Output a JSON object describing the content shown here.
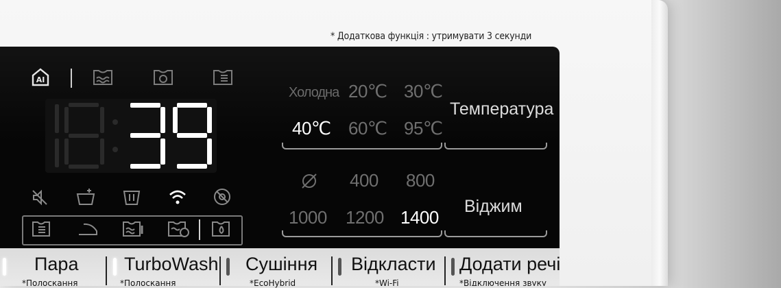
{
  "note": "* Додаткова функція : утримувати 3 секунди",
  "display": {
    "time": "39",
    "icons": [
      "ai-icon",
      "wash-icon",
      "rinse-icon",
      "spin-icon",
      "mute-icon",
      "detergent-icon",
      "tub-clean-icon",
      "wifi-icon",
      "child-lock-icon",
      "steam-icon",
      "iron-icon",
      "temp-dry-icon",
      "timed-dry-icon",
      "drip-icon"
    ]
  },
  "temperature": {
    "title": "Температура",
    "options": [
      "Холодна",
      "20℃",
      "30℃",
      "40℃",
      "60℃",
      "95℃"
    ],
    "selected": "40℃"
  },
  "spin": {
    "title": "Віджим",
    "options": [
      "400",
      "800",
      "1000",
      "1200",
      "1400"
    ],
    "selected": "1400"
  },
  "buttons": [
    {
      "label": "Пара",
      "sub": "*Полоскання"
    },
    {
      "label": "TurboWash",
      "sub": "*Полоскання"
    },
    {
      "label": "Сушіння",
      "sub": "*EcoHybrid"
    },
    {
      "label": "Відкласти",
      "sub": "*Wi-Fi"
    },
    {
      "label": "Додати речі",
      "sub": "*Відключення звуку"
    }
  ]
}
